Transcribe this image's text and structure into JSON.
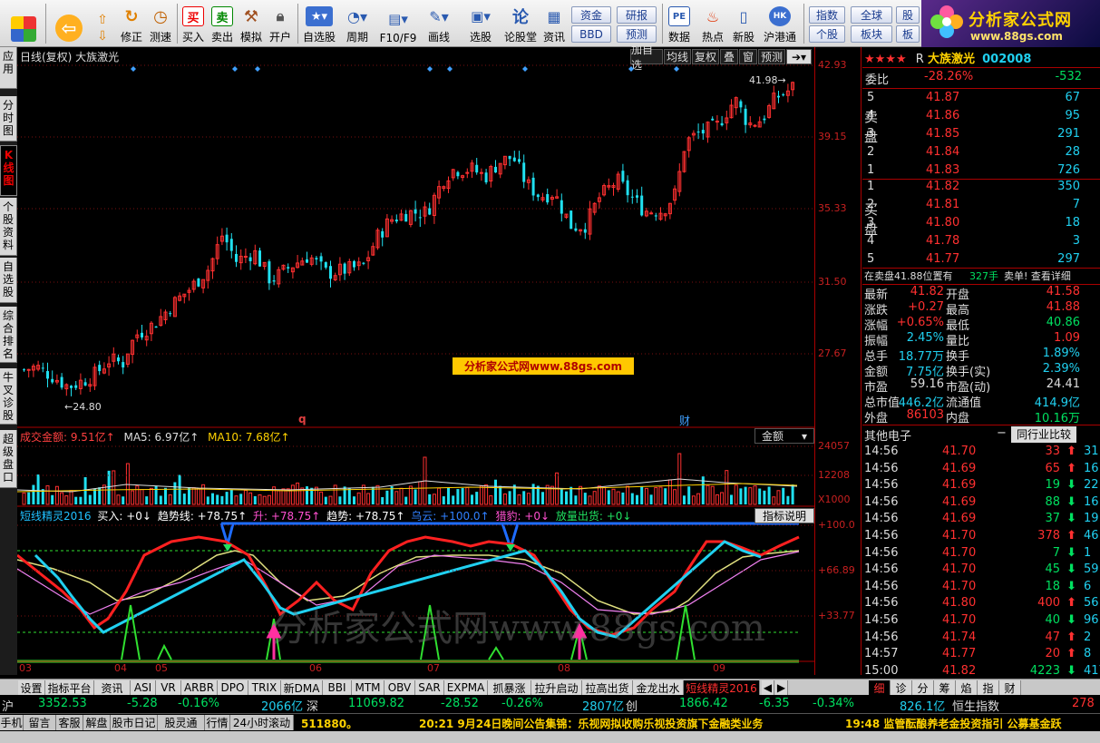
{
  "toolbar": {
    "items": [
      "",
      "",
      "修正",
      "测速",
      "买入",
      "卖出",
      "模拟",
      "开户",
      "自选股",
      "周期",
      "F10/F9",
      "画线",
      "选股",
      "论股堂",
      "资讯",
      "数据",
      "热点",
      "新股",
      "沪港通"
    ],
    "small_buttons": [
      "资金",
      "研报",
      "BBD",
      "预测",
      "指数",
      "全球",
      "股",
      "个股",
      "板块",
      "板"
    ],
    "logo_title": "分析家公式网",
    "logo_url": "www.88gs.com"
  },
  "left_tabs": [
    "应用",
    "分时图",
    "K线图",
    "个股资料",
    "自选股",
    "综合排名",
    "牛叉诊股",
    "超级盘口"
  ],
  "chart": {
    "title": "日线(复权) 大族激光",
    "controls": [
      "加自选",
      "均线",
      "复权",
      "叠",
      "窗",
      "预测"
    ],
    "y_ticks": [
      "42.93",
      "39.15",
      "35.33",
      "31.50",
      "27.67"
    ],
    "high_label": "41.98",
    "low_label": "24.80",
    "marker_q": "q",
    "marker_cai": "财",
    "watermark_banner": "分析家公式网www.88gs.com"
  },
  "volume": {
    "title": "成交金额: 9.51亿↑",
    "ma5": "MA5: 6.97亿↑",
    "ma10": "MA10: 7.68亿↑",
    "select": "金额",
    "ticks": [
      "24057",
      "12208",
      "X1000"
    ]
  },
  "indicator": {
    "name": "短线精灵2016",
    "buy": "买入: +0↓",
    "trend_line": "趋势线: +78.75↑",
    "rise": "升: +78.75↑",
    "trend": "趋势: +78.75↑",
    "wuyun": "乌云: +100.0↑",
    "lie": "猎豹: +0↓",
    "ship": "放量出货: +0↓",
    "help": "指标说明",
    "ticks": [
      "+100.0",
      "+66.89",
      "+33.77"
    ],
    "watermark": "分析家公式网www.88gs.com"
  },
  "x_labels": [
    "03",
    "04",
    "05",
    "06",
    "07",
    "08",
    "09"
  ],
  "quote": {
    "stars": "★★★★",
    "r_flag": "R",
    "name": "大族激光",
    "code": "002008",
    "weibi_label": "委比",
    "weibi": "-28.26%",
    "weicha": "-532",
    "sell_label": [
      "卖",
      "盘"
    ],
    "buy_label": [
      "买",
      "盘"
    ],
    "sell": [
      {
        "lvl": "5",
        "price": "41.87",
        "vol": "67"
      },
      {
        "lvl": "4",
        "price": "41.86",
        "vol": "95"
      },
      {
        "lvl": "3",
        "price": "41.85",
        "vol": "291"
      },
      {
        "lvl": "2",
        "price": "41.84",
        "vol": "28"
      },
      {
        "lvl": "1",
        "price": "41.83",
        "vol": "726"
      }
    ],
    "buy": [
      {
        "lvl": "1",
        "price": "41.82",
        "vol": "350"
      },
      {
        "lvl": "2",
        "price": "41.81",
        "vol": "7"
      },
      {
        "lvl": "3",
        "price": "41.80",
        "vol": "18"
      },
      {
        "lvl": "4",
        "price": "41.78",
        "vol": "3"
      },
      {
        "lvl": "5",
        "price": "41.77",
        "vol": "297"
      }
    ],
    "notice": "在卖盘41.88位置有",
    "notice_vol": "327手",
    "notice_act": "卖单! 查看详细",
    "stats": [
      {
        "l1": "最新",
        "v1": "41.82",
        "c1": "r",
        "l2": "开盘",
        "v2": "41.58",
        "c2": "r"
      },
      {
        "l1": "涨跌",
        "v1": "+0.27",
        "c1": "r",
        "l2": "最高",
        "v2": "41.88",
        "c2": "r"
      },
      {
        "l1": "涨幅",
        "v1": "+0.65%",
        "c1": "r",
        "l2": "最低",
        "v2": "40.86",
        "c2": "g"
      },
      {
        "l1": "振幅",
        "v1": "2.45%",
        "c1": "c",
        "l2": "量比",
        "v2": "1.09",
        "c2": "r"
      },
      {
        "l1": "总手",
        "v1": "18.77万",
        "c1": "c",
        "l2": "换手",
        "v2": "1.89%",
        "c2": "c"
      },
      {
        "l1": "金额",
        "v1": "7.75亿",
        "c1": "c",
        "l2": "换手(实)",
        "v2": "2.39%",
        "c2": "c"
      },
      {
        "l1": "市盈",
        "v1": "59.16",
        "c1": "w",
        "l2": "市盈(动)",
        "v2": "24.41",
        "c2": "w"
      },
      {
        "l1": "总市值",
        "v1": "446.2亿",
        "c1": "c",
        "l2": "流通值",
        "v2": "414.9亿",
        "c2": "c"
      },
      {
        "l1": "外盘",
        "v1": "86103",
        "c1": "r",
        "l2": "内盘",
        "v2": "10.16万",
        "c2": "g"
      }
    ],
    "sector": "其他电子",
    "sector_compare": "同行业比较",
    "ticks": [
      {
        "t": "14:56",
        "p": "41.70",
        "v": "33",
        "d": "up"
      },
      {
        "t": "14:56",
        "p": "41.69",
        "v": "65",
        "d": "up"
      },
      {
        "t": "14:56",
        "p": "41.69",
        "v": "19",
        "d": "down"
      },
      {
        "t": "14:56",
        "p": "41.69",
        "v": "88",
        "d": "down"
      },
      {
        "t": "14:56",
        "p": "41.69",
        "v": "37",
        "d": "down"
      },
      {
        "t": "14:56",
        "p": "41.70",
        "v": "378",
        "d": "up"
      },
      {
        "t": "14:56",
        "p": "41.70",
        "v": "7",
        "d": "down"
      },
      {
        "t": "14:56",
        "p": "41.70",
        "v": "45",
        "d": "down"
      },
      {
        "t": "14:56",
        "p": "41.70",
        "v": "18",
        "d": "down"
      },
      {
        "t": "14:56",
        "p": "41.80",
        "v": "400",
        "d": "up"
      },
      {
        "t": "14:56",
        "p": "41.70",
        "v": "40",
        "d": "down"
      },
      {
        "t": "14:56",
        "p": "41.74",
        "v": "47",
        "d": "up"
      },
      {
        "t": "14:57",
        "p": "41.77",
        "v": "20",
        "d": "up"
      },
      {
        "t": "15:00",
        "p": "41.82",
        "v": "4223",
        "d": "down"
      }
    ],
    "edge_ticks": [
      "31",
      "16",
      "22",
      "16",
      "19",
      "46",
      "1",
      "59",
      "6",
      "56",
      "96",
      "2",
      "8",
      "417"
    ],
    "edge_chars": [
      "3",
      "3",
      "浅",
      "",
      "7",
      "中",
      "小",
      "浅",
      "浅",
      "浅",
      "日",
      "今",
      "",
      "",
      "",
      "",
      "",
      "名",
      "白",
      "家",
      "责",
      "逛",
      "超",
      "通",
      "贝",
      "刀",
      "万"
    ],
    "bottom_tabs": [
      "细",
      "诊",
      "分",
      "筹",
      "焰",
      "指",
      "财"
    ]
  },
  "bottom_tabs": [
    "设置",
    "指标平台",
    "资讯",
    "ASI",
    "VR",
    "ARBR",
    "DPO",
    "TRIX",
    "新DMA",
    "BBI",
    "MTM",
    "OBV",
    "SAR",
    "EXPMA",
    "抓暴涨",
    "拉升启动",
    "拉高出货",
    "金龙出水",
    "短线精灵2016"
  ],
  "ticker": {
    "sh_label": "沪",
    "sh_val": "3352.53",
    "sh_chg": "-5.28",
    "sh_pct": "-0.16%",
    "sh_amt": "2066亿",
    "sz_label": "深",
    "sz_val": "11069.82",
    "sz_chg": "-28.52",
    "sz_pct": "-0.26%",
    "sz_amt": "2807亿",
    "cy_label": "创",
    "cy_val": "1866.42",
    "cy_chg": "-6.35",
    "cy_pct": "-0.34%",
    "cy_amt": "826.1亿",
    "hs_label": "恒生指数",
    "hs_val": "278"
  },
  "status": {
    "buttons": [
      "手机",
      "留言",
      "客服",
      "解盘",
      "股市日记",
      "股灵通",
      "行情",
      "24小时滚动"
    ],
    "code": "511880。",
    "news1": "20:21 9月24日晚间公告集锦：乐视网拟收购乐视投资旗下金融类业务",
    "news2": "19:48 监管酝酿养老金投资指引 公募基金跃"
  },
  "colors": {
    "up": "#ff3030",
    "down": "#20e0f0",
    "grid": "#8a1010"
  }
}
